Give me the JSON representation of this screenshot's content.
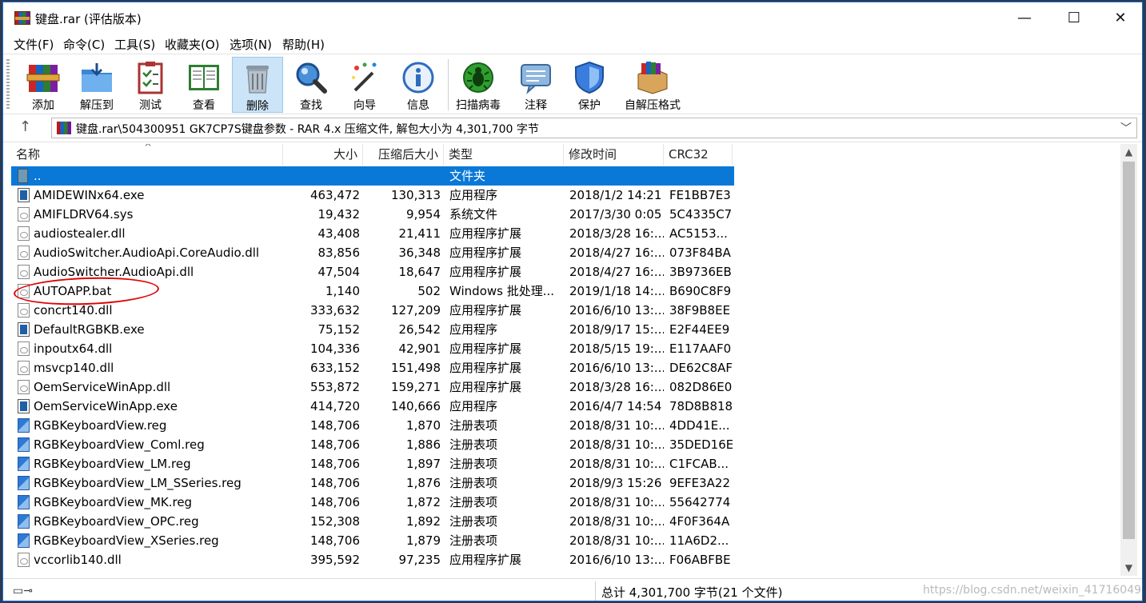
{
  "window": {
    "title": "键盘.rar (评估版本)"
  },
  "window_controls": {
    "minimize": "—",
    "maximize": "☐",
    "close": "✕"
  },
  "menu": [
    "文件(F)",
    "命令(C)",
    "工具(S)",
    "收藏夹(O)",
    "选项(N)",
    "帮助(H)"
  ],
  "toolbar": {
    "buttons": [
      {
        "label": "添加",
        "icon": "add-archive-icon"
      },
      {
        "label": "解压到",
        "icon": "extract-folder-icon"
      },
      {
        "label": "测试",
        "icon": "test-clipboard-icon"
      },
      {
        "label": "查看",
        "icon": "view-book-icon"
      },
      {
        "label": "删除",
        "icon": "trash-icon"
      },
      {
        "label": "查找",
        "icon": "magnifier-icon"
      },
      {
        "label": "向导",
        "icon": "wizard-wand-icon"
      },
      {
        "label": "信息",
        "icon": "info-icon"
      },
      {
        "label": "扫描病毒",
        "icon": "virus-scan-icon"
      },
      {
        "label": "注释",
        "icon": "comment-icon"
      },
      {
        "label": "保护",
        "icon": "shield-icon"
      },
      {
        "label": "自解压格式",
        "icon": "sfx-box-icon"
      }
    ]
  },
  "address": {
    "path": "键盘.rar\\504300951 GK7CP7S键盘参数 - RAR 4.x 压缩文件, 解包大小为 4,301,700 字节"
  },
  "columns": {
    "name": "名称",
    "size": "大小",
    "packed": "压缩后大小",
    "type": "类型",
    "mtime": "修改时间",
    "crc": "CRC32"
  },
  "files": [
    {
      "name": "..",
      "size": "",
      "packed": "",
      "type": "文件夹",
      "mtime": "",
      "crc": "",
      "icon": "folder"
    },
    {
      "name": "AMIDEWINx64.exe",
      "size": "463,472",
      "packed": "130,313",
      "type": "应用程序",
      "mtime": "2018/1/2 14:21",
      "crc": "FE1BB7E3",
      "icon": "exe"
    },
    {
      "name": "AMIFLDRV64.sys",
      "size": "19,432",
      "packed": "9,954",
      "type": "系统文件",
      "mtime": "2017/3/30 0:05",
      "crc": "5C4335C7",
      "icon": "file"
    },
    {
      "name": "audiostealer.dll",
      "size": "43,408",
      "packed": "21,411",
      "type": "应用程序扩展",
      "mtime": "2018/3/28 16:...",
      "crc": "AC5153...",
      "icon": "file"
    },
    {
      "name": "AudioSwitcher.AudioApi.CoreAudio.dll",
      "size": "83,856",
      "packed": "36,348",
      "type": "应用程序扩展",
      "mtime": "2018/4/27 16:...",
      "crc": "073F84BA",
      "icon": "file"
    },
    {
      "name": "AudioSwitcher.AudioApi.dll",
      "size": "47,504",
      "packed": "18,647",
      "type": "应用程序扩展",
      "mtime": "2018/4/27 16:...",
      "crc": "3B9736EB",
      "icon": "file"
    },
    {
      "name": "AUTOAPP.bat",
      "size": "1,140",
      "packed": "502",
      "type": "Windows 批处理...",
      "mtime": "2019/1/18 14:...",
      "crc": "B690C8F9",
      "icon": "file"
    },
    {
      "name": "concrt140.dll",
      "size": "333,632",
      "packed": "127,209",
      "type": "应用程序扩展",
      "mtime": "2016/6/10 13:...",
      "crc": "38F9B8EE",
      "icon": "file"
    },
    {
      "name": "DefaultRGBKB.exe",
      "size": "75,152",
      "packed": "26,542",
      "type": "应用程序",
      "mtime": "2018/9/17 15:...",
      "crc": "E2F44EE9",
      "icon": "exe"
    },
    {
      "name": "inpoutx64.dll",
      "size": "104,336",
      "packed": "42,901",
      "type": "应用程序扩展",
      "mtime": "2018/5/15 19:...",
      "crc": "E117AAF0",
      "icon": "file"
    },
    {
      "name": "msvcp140.dll",
      "size": "633,152",
      "packed": "151,498",
      "type": "应用程序扩展",
      "mtime": "2016/6/10 13:...",
      "crc": "DE62C8AF",
      "icon": "file"
    },
    {
      "name": "OemServiceWinApp.dll",
      "size": "553,872",
      "packed": "159,271",
      "type": "应用程序扩展",
      "mtime": "2018/3/28 16:...",
      "crc": "082D86E0",
      "icon": "file"
    },
    {
      "name": "OemServiceWinApp.exe",
      "size": "414,720",
      "packed": "140,666",
      "type": "应用程序",
      "mtime": "2016/4/7 14:54",
      "crc": "78D8B818",
      "icon": "exe"
    },
    {
      "name": "RGBKeyboardView.reg",
      "size": "148,706",
      "packed": "1,870",
      "type": "注册表项",
      "mtime": "2018/8/31 10:...",
      "crc": "4DD41E...",
      "icon": "reg"
    },
    {
      "name": "RGBKeyboardView_Coml.reg",
      "size": "148,706",
      "packed": "1,886",
      "type": "注册表项",
      "mtime": "2018/8/31 10:...",
      "crc": "35DED16E",
      "icon": "reg"
    },
    {
      "name": "RGBKeyboardView_LM.reg",
      "size": "148,706",
      "packed": "1,897",
      "type": "注册表项",
      "mtime": "2018/8/31 10:...",
      "crc": "C1FCAB...",
      "icon": "reg"
    },
    {
      "name": "RGBKeyboardView_LM_SSeries.reg",
      "size": "148,706",
      "packed": "1,876",
      "type": "注册表项",
      "mtime": "2018/9/3 15:26",
      "crc": "9EFE3A22",
      "icon": "reg"
    },
    {
      "name": "RGBKeyboardView_MK.reg",
      "size": "148,706",
      "packed": "1,872",
      "type": "注册表项",
      "mtime": "2018/8/31 10:...",
      "crc": "55642774",
      "icon": "reg"
    },
    {
      "name": "RGBKeyboardView_OPC.reg",
      "size": "152,308",
      "packed": "1,892",
      "type": "注册表项",
      "mtime": "2018/8/31 10:...",
      "crc": "4F0F364A",
      "icon": "reg"
    },
    {
      "name": "RGBKeyboardView_XSeries.reg",
      "size": "148,706",
      "packed": "1,879",
      "type": "注册表项",
      "mtime": "2018/8/31 10:...",
      "crc": "11A6D2...",
      "icon": "reg"
    },
    {
      "name": "vccorlib140.dll",
      "size": "395,592",
      "packed": "97,235",
      "type": "应用程序扩展",
      "mtime": "2016/6/10 13:...",
      "crc": "F06ABFBE",
      "icon": "file"
    }
  ],
  "status": {
    "summary": "总计 4,301,700 字节(21 个文件)",
    "watermark": "https://blog.csdn.net/weixin_41716049"
  },
  "colors": {
    "selection": "#0a78d7",
    "annotation": "#e00000"
  }
}
